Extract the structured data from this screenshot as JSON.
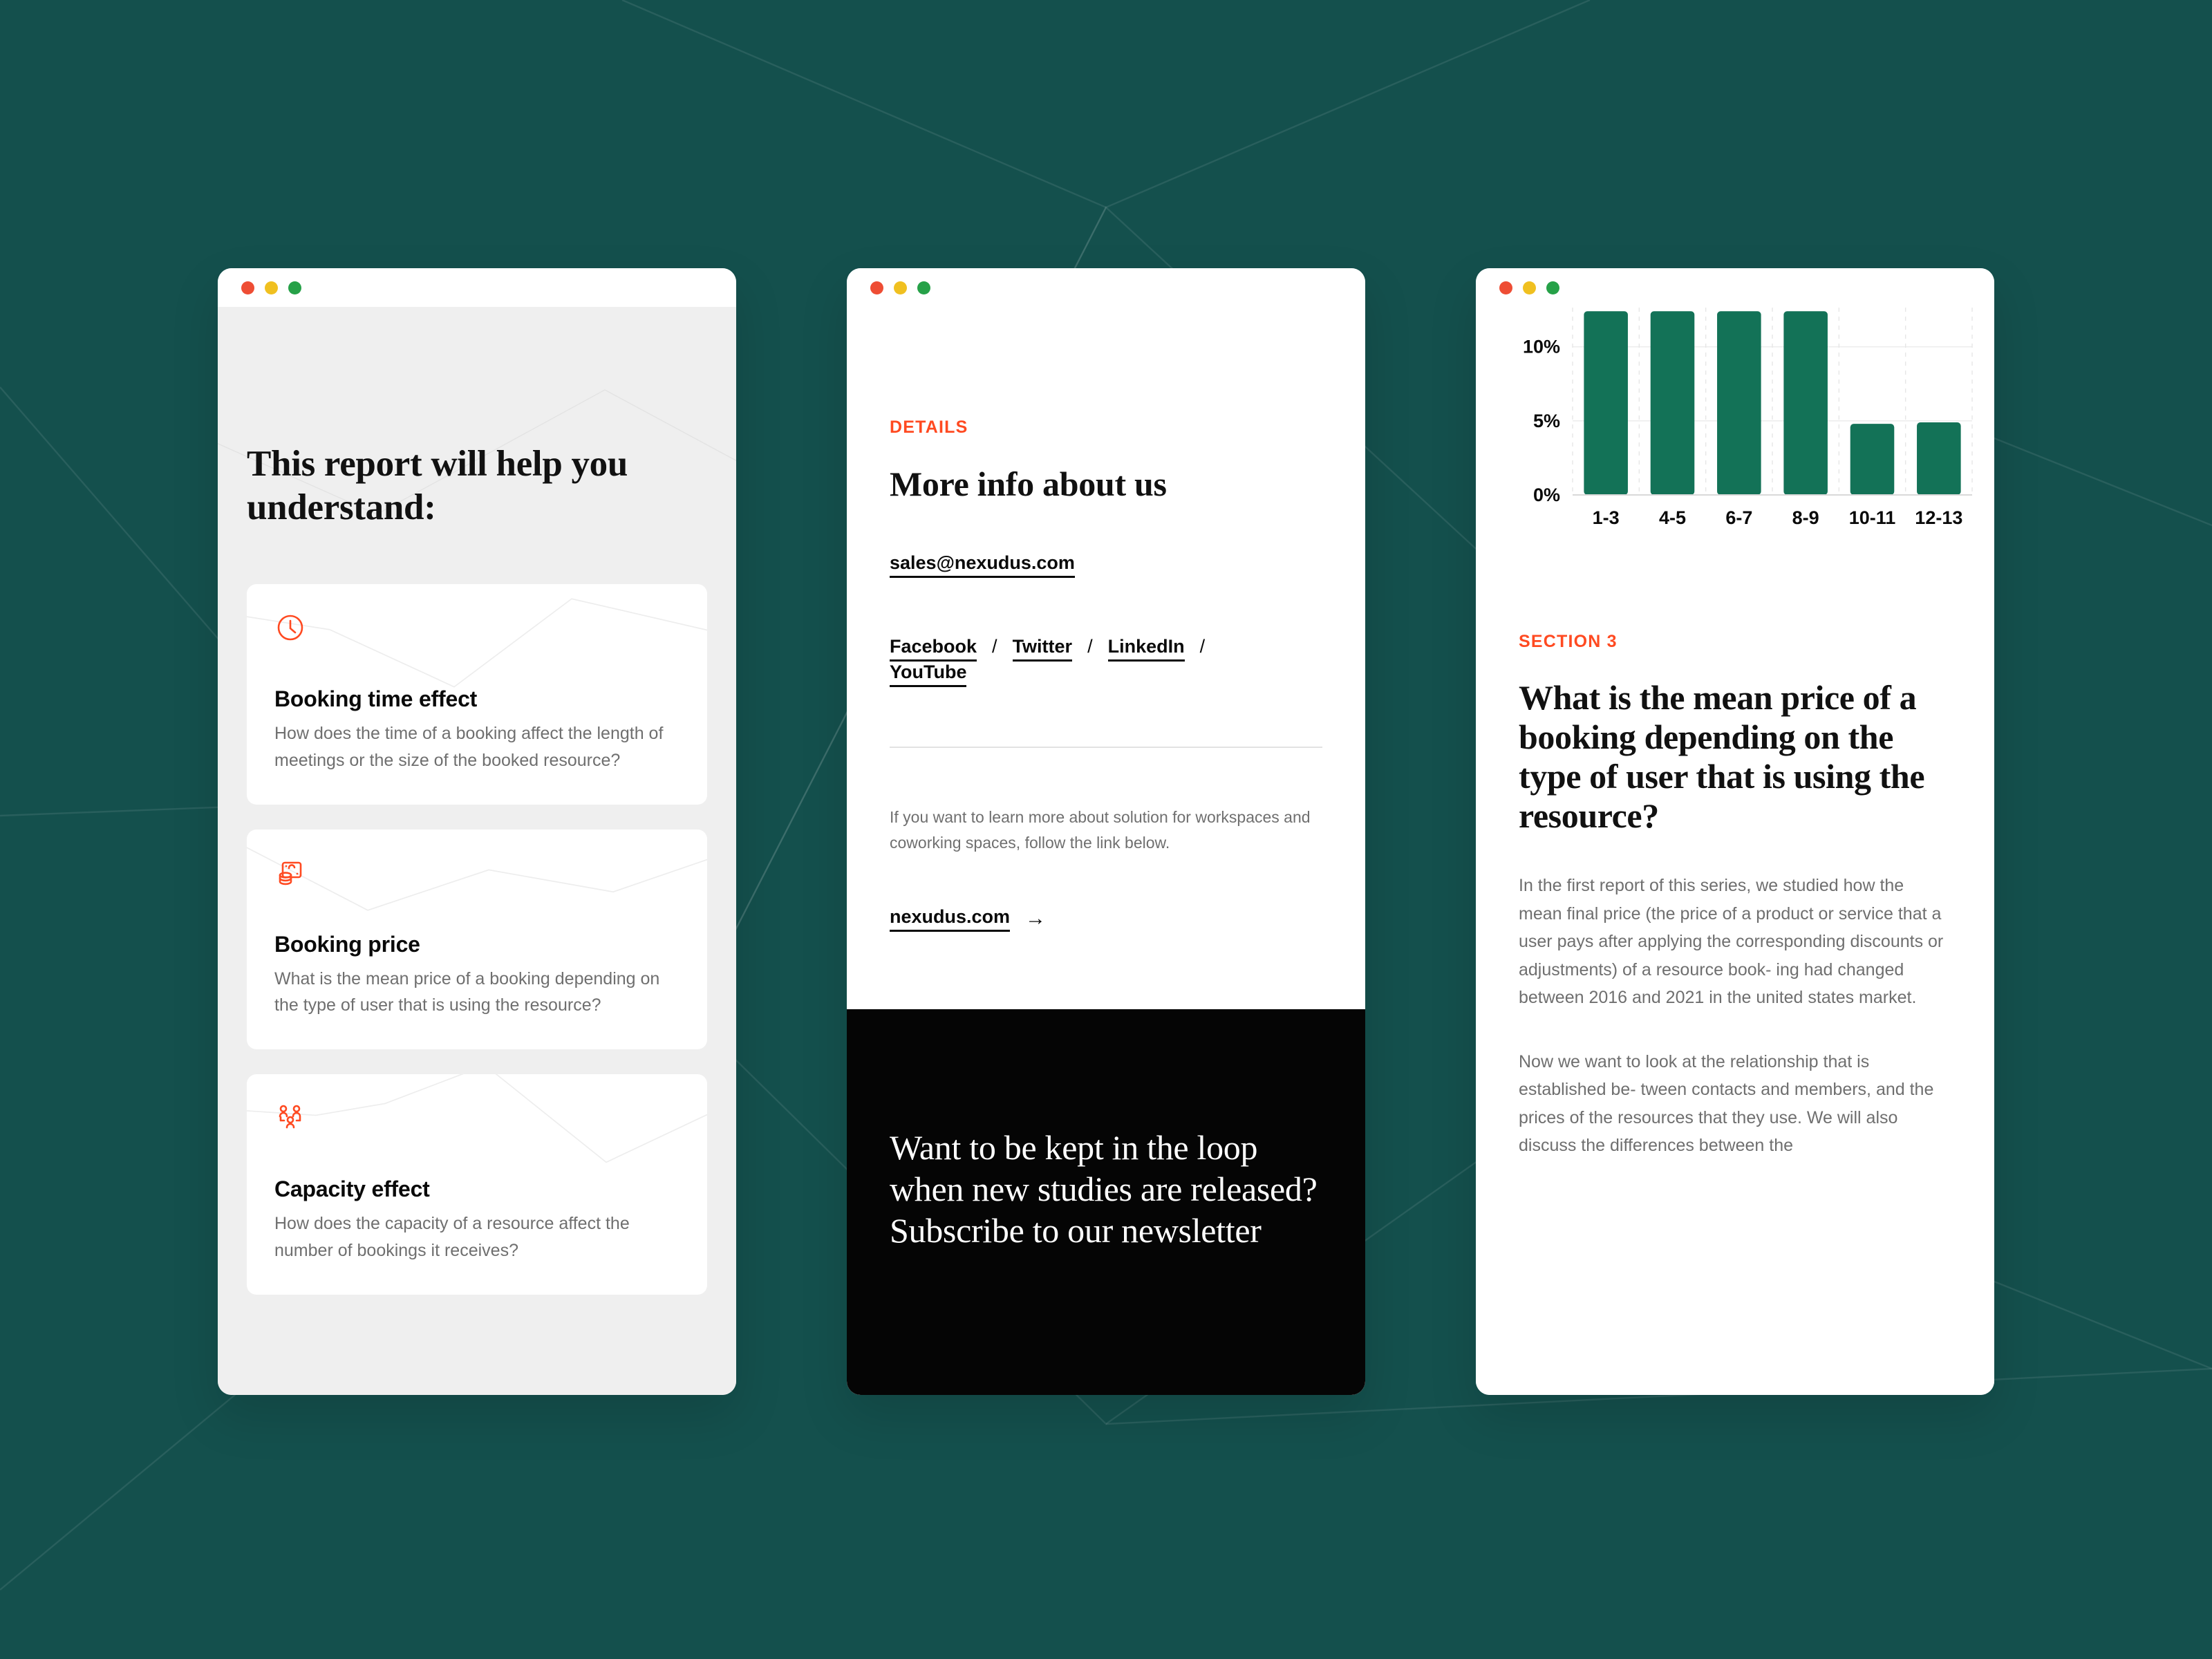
{
  "theme": {
    "background": "#14504d",
    "accent_orange": "#ff4a21",
    "chart_green": "#137257",
    "card_bg_gray": "#efefef",
    "newsletter_bg": "#050505",
    "dot_red": "#ee4d34",
    "dot_yellow": "#f0c020",
    "dot_green": "#26a148"
  },
  "panel1": {
    "heading": "This report will help you understand:",
    "cards": [
      {
        "icon": "clock-icon",
        "title": "Booking time effect",
        "description": "How does the time of a booking affect the length of meetings or the size of the booked resource?"
      },
      {
        "icon": "money-coins-icon",
        "title": "Booking price",
        "description": "What is the mean price of a booking depending on the type of user that is using the resource?"
      },
      {
        "icon": "people-group-icon",
        "title": "Capacity effect",
        "description": "How does the capacity of a resource affect the number of bookings it receives?"
      }
    ]
  },
  "panel2": {
    "eyebrow": "DETAILS",
    "heading": "More info about us",
    "email": "sales@nexudus.com",
    "social": [
      {
        "label": "Facebook",
        "separator": "/"
      },
      {
        "label": "Twitter",
        "separator": "/"
      },
      {
        "label": "LinkedIn",
        "separator": "/"
      },
      {
        "label": "YouTube",
        "separator": ""
      }
    ],
    "note": "If you want to learn more about solution for workspaces and coworking spaces, follow the link below.",
    "site_link": "nexudus.com",
    "arrow": "→",
    "newsletter_heading": "Want to be kept in the loop when new studies are released? Subscribe to our newsletter"
  },
  "panel3": {
    "eyebrow": "SECTION 3",
    "heading": "What is the mean price of a booking depending on the type of user that is using the resource?",
    "paragraphs": [
      "In the first report of this series, we studied how the mean final price (the price of a product or service that a user pays after applying the corresponding discounts or adjustments) of a resource book- ing had changed between 2016 and 2021 in the united states market.",
      "Now we want to look at the relationship that is established be- tween contacts and members, and the prices of the resources that they use. We will also discuss the differences between the"
    ]
  },
  "chart_data": {
    "type": "bar",
    "title": "",
    "xlabel": "",
    "ylabel": "",
    "categories": [
      "1-3",
      "4-5",
      "6-7",
      "8-9",
      "10-11",
      "12-13"
    ],
    "values": [
      12.4,
      12.4,
      12.4,
      12.4,
      4.8,
      4.9
    ],
    "ytick_labels": [
      "0%",
      "5%",
      "10%"
    ],
    "yticks": [
      0,
      5,
      10
    ],
    "ylim": [
      0,
      12.6
    ],
    "grid": true,
    "legend": null,
    "note": "top of first four bars is clipped by the window viewport",
    "bar_color": "#137257"
  }
}
